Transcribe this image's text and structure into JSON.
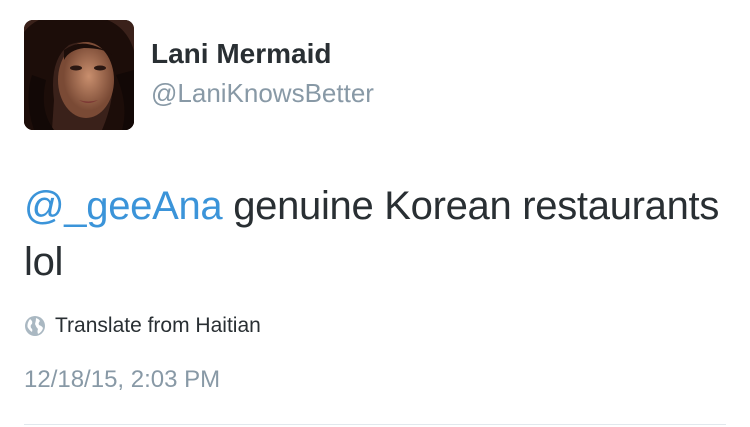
{
  "user": {
    "display_name": "Lani Mermaid",
    "handle": "@LaniKnowsBetter",
    "avatar_icon": "profile-photo"
  },
  "tweet": {
    "mention": "@_geeAna",
    "text": " genuine Korean restaurants lol",
    "translate_label": "Translate from Haitian",
    "translate_icon": "globe-icon",
    "timestamp": "12/18/15, 2:03 PM"
  },
  "colors": {
    "link": "#3b94d9",
    "text": "#292f33",
    "secondary": "#8899a6"
  }
}
